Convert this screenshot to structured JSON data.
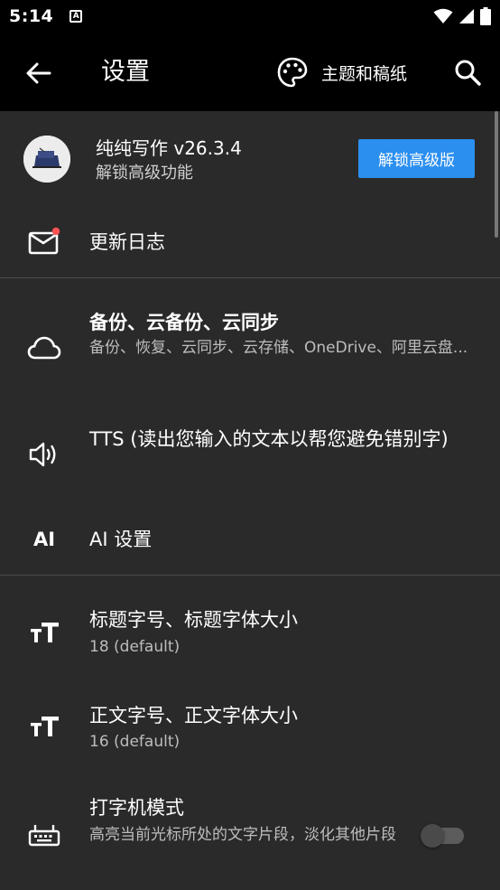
{
  "status": {
    "time": "5:14",
    "a_badge": "A"
  },
  "appbar": {
    "title": "设置",
    "theme_label": "主题和稿纸"
  },
  "header": {
    "app_name": "纯纯写作 v26.3.4",
    "subtitle": "解锁高级功能",
    "unlock_label": "解锁高级版"
  },
  "items": [
    {
      "title": "更新日志",
      "icon": "mail-icon"
    },
    {
      "title": "备份、云备份、云同步",
      "subtitle": "备份、恢复、云同步、云存储、OneDrive、阿里云盘...",
      "icon": "cloud-icon"
    },
    {
      "title": "TTS (读出您输入的文本以帮您避免错别字)",
      "icon": "speaker-icon"
    },
    {
      "title": "AI 设置",
      "icon_text": "AI",
      "icon": "ai-icon"
    },
    {
      "title": "标题字号、标题字体大小",
      "subtitle": "18 (default)",
      "icon": "text-size-icon"
    },
    {
      "title": "正文字号、正文字体大小",
      "subtitle": "16 (default)",
      "icon": "text-size-icon"
    },
    {
      "title": "打字机模式",
      "subtitle": "高亮当前光标所处的文字片段，淡化其他片段",
      "icon": "typewriter-icon"
    }
  ],
  "colors": {
    "accent": "#2b8ff0",
    "background": "#2a2a2a",
    "bar": "#000000"
  }
}
